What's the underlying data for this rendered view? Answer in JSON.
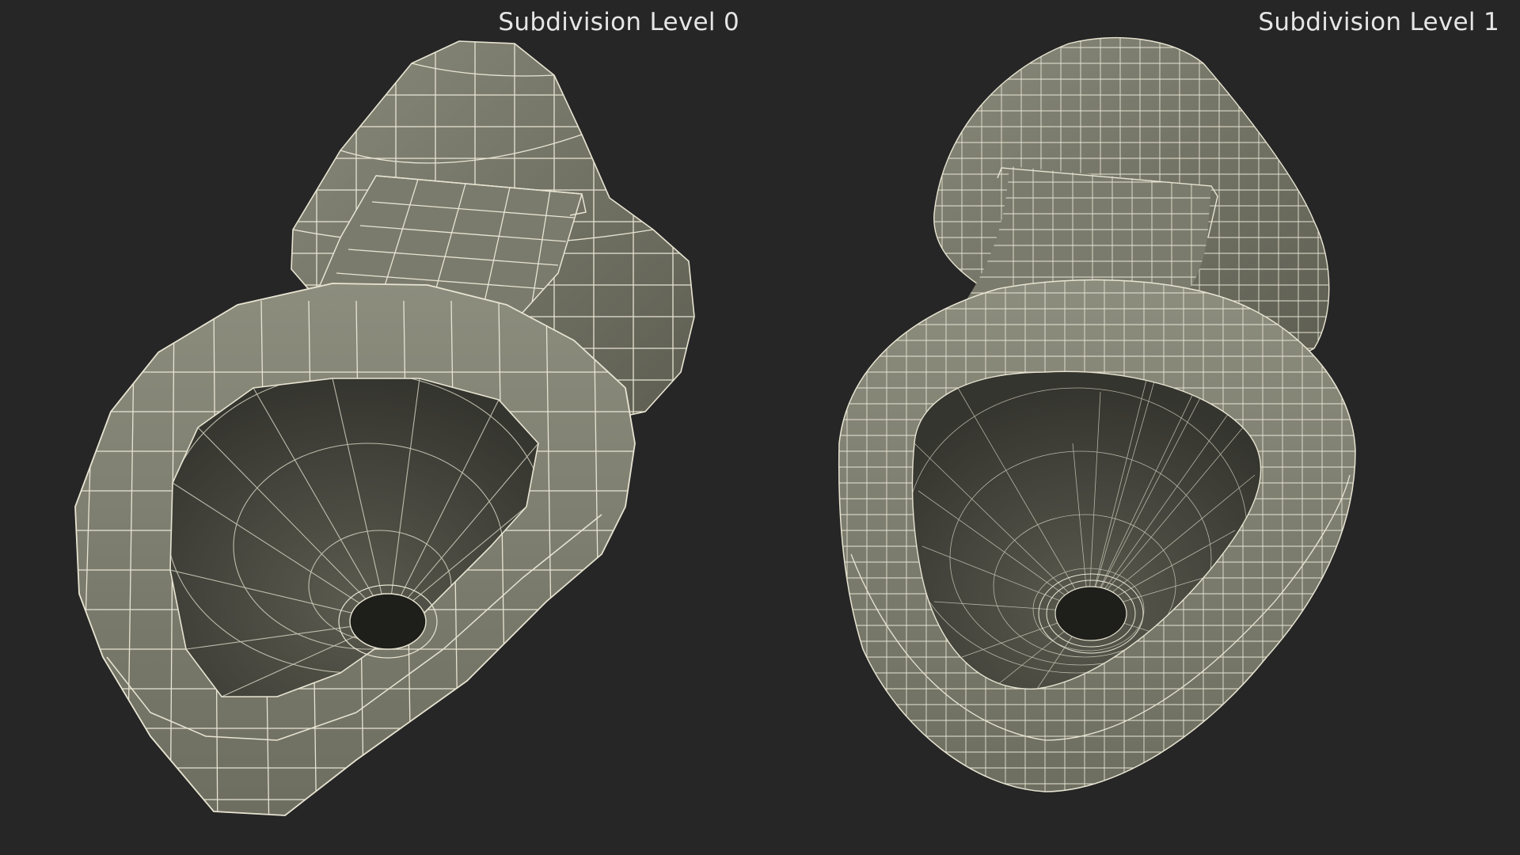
{
  "views": [
    {
      "label": "Subdivision Level 0",
      "subdivision": 0,
      "grid_density": 0.5
    },
    {
      "label": "Subdivision Level 1",
      "subdivision": 1,
      "grid_density": 1.0
    }
  ],
  "colors": {
    "background": "#262626",
    "surface": "#7f7f70",
    "surface_dark": "#5a5a4e",
    "surface_inner": "#43433a",
    "wire": "#e8e4d2",
    "drain": "#1e1e1a",
    "label": "#e6e6e6"
  }
}
